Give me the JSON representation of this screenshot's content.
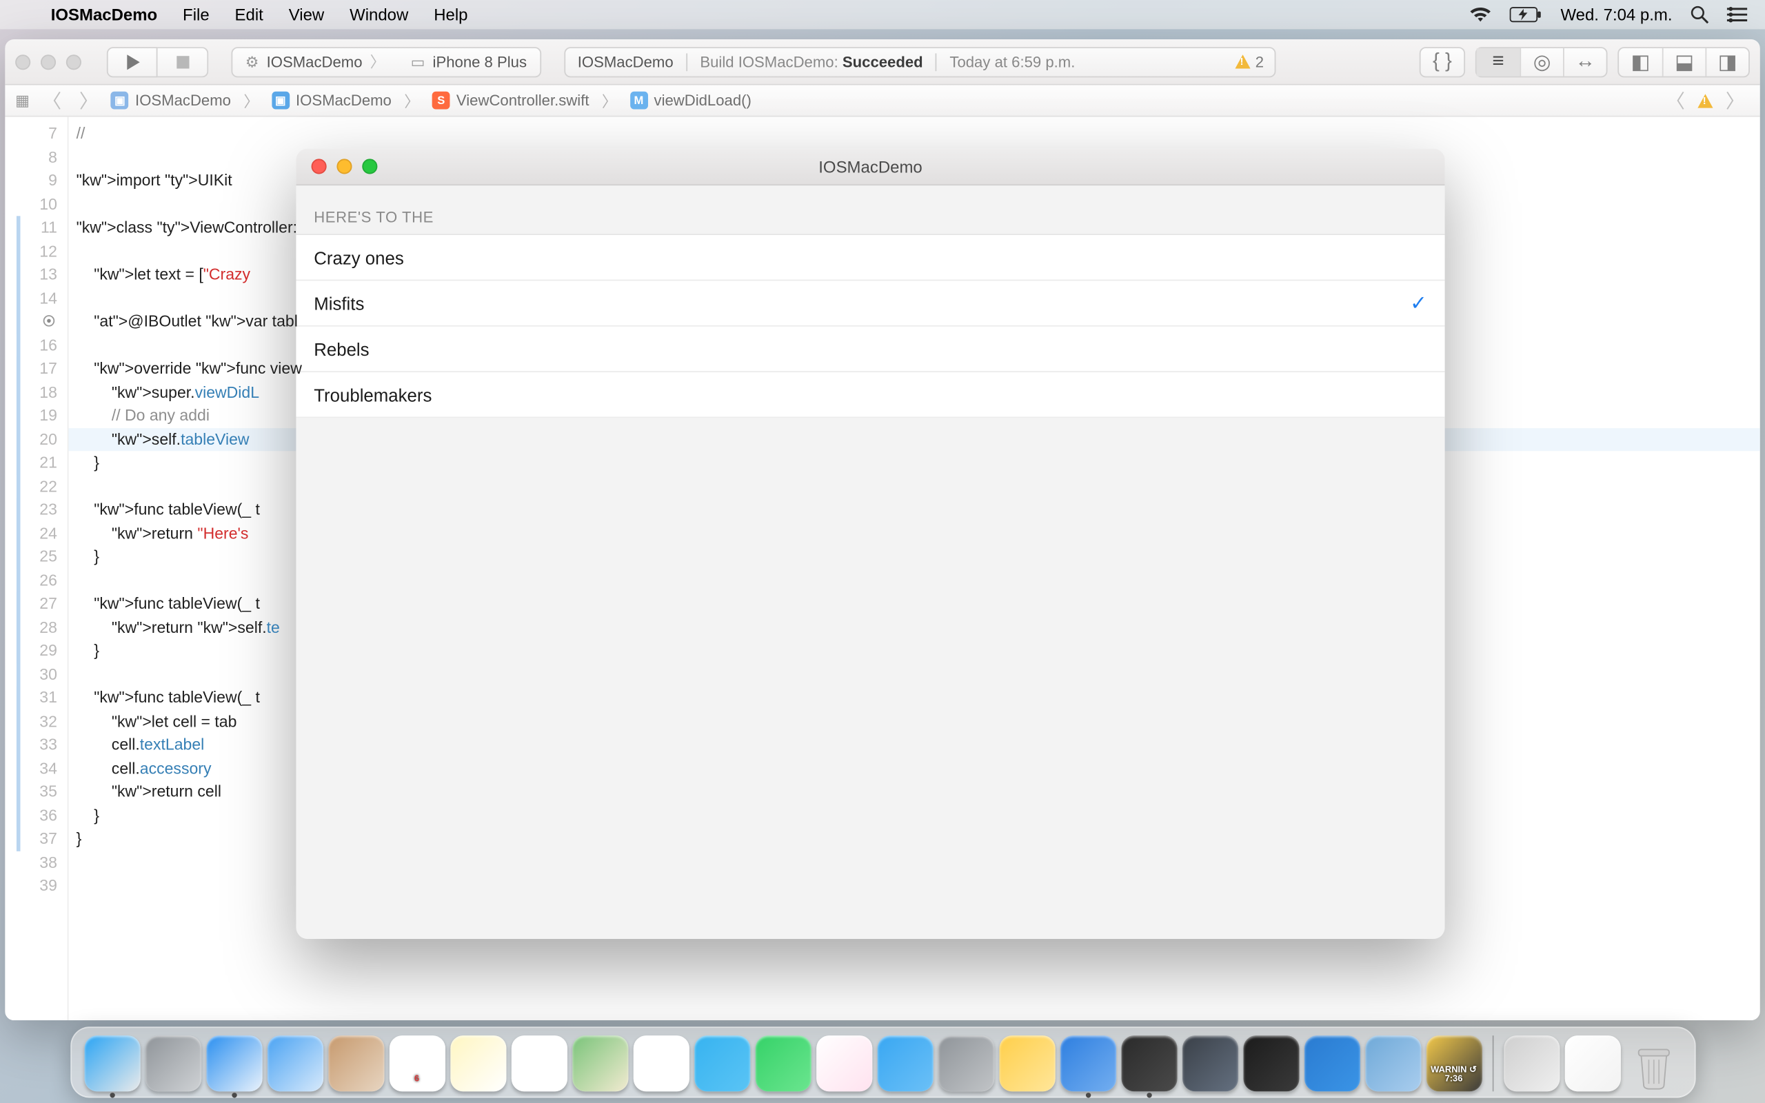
{
  "menubar": {
    "app": "IOSMacDemo",
    "items": [
      "File",
      "Edit",
      "View",
      "Window",
      "Help"
    ],
    "clock": "Wed. 7:04 p.m."
  },
  "xcode": {
    "scheme": {
      "project": "IOSMacDemo",
      "device": "iPhone 8 Plus"
    },
    "activity": {
      "project": "IOSMacDemo",
      "prefix": "Build IOSMacDemo: ",
      "status": "Succeeded",
      "time": "Today at 6:59 p.m.",
      "warn_count": "2"
    },
    "breadcrumbs": {
      "p0": "IOSMacDemo",
      "p1": "IOSMacDemo",
      "p2": "ViewController.swift",
      "p3": "viewDidLoad()"
    },
    "gutter_start": 7,
    "gutter_end": 39,
    "highlight_line": 20,
    "code_lines": [
      "//",
      "",
      "import UIKit",
      "",
      "class ViewController: ",
      "",
      "    let text = [\"Crazy",
      "",
      "    @IBOutlet var tabl",
      "",
      "    override func view",
      "        super.viewDidL",
      "        // Do any addi",
      "        self.tableView",
      "    }",
      "",
      "    func tableView(_ t",
      "        return \"Here's",
      "    }",
      "",
      "    func tableView(_ t",
      "        return self.te",
      "    }",
      "",
      "    func tableView(_ t",
      "        let cell = tab",
      "        cell.textLabel",
      "        cell.accessory",
      "        return cell",
      "    }",
      "}",
      "",
      ""
    ],
    "blue_bars": [
      [
        11,
        37
      ],
      [
        15,
        15
      ],
      [
        17,
        21
      ],
      [
        23,
        25
      ],
      [
        27,
        29
      ],
      [
        31,
        36
      ]
    ]
  },
  "appwin": {
    "title": "IOSMacDemo",
    "section": "HERE'S TO THE",
    "rows": [
      {
        "label": "Crazy ones",
        "checked": false
      },
      {
        "label": "Misfits",
        "checked": true
      },
      {
        "label": "Rebels",
        "checked": false
      },
      {
        "label": "Troublemakers",
        "checked": false
      }
    ]
  },
  "dock": {
    "apps": [
      {
        "n": "finder",
        "c1": "#2aa4f4",
        "c2": "#eaeaea",
        "running": true
      },
      {
        "n": "launchpad",
        "c1": "#8f9499",
        "c2": "#cfd2d5"
      },
      {
        "n": "safari",
        "c1": "#2a8ff0",
        "c2": "#eaf2fb",
        "running": true
      },
      {
        "n": "mail",
        "c1": "#4aa3f3",
        "c2": "#d7e9fb"
      },
      {
        "n": "contacts",
        "c1": "#c79a6e",
        "c2": "#e7d5c1"
      },
      {
        "n": "calendar",
        "c1": "#ffffff",
        "c2": "#ffffff",
        "lbl": "6",
        "lblc": "#d83939"
      },
      {
        "n": "notes",
        "c1": "#fff6c2",
        "c2": "#fff"
      },
      {
        "n": "reminders",
        "c1": "#ffffff",
        "c2": "#ffffff"
      },
      {
        "n": "maps",
        "c1": "#7ac47a",
        "c2": "#f1ead0"
      },
      {
        "n": "photos",
        "c1": "#ffffff",
        "c2": "#ffffff"
      },
      {
        "n": "messages",
        "c1": "#37b3f0",
        "c2": "#5ac4f5"
      },
      {
        "n": "facetime",
        "c1": "#35d268",
        "c2": "#6be58f"
      },
      {
        "n": "itunes",
        "c1": "#ffffff",
        "c2": "#ffe2ef"
      },
      {
        "n": "appstore",
        "c1": "#39a7f2",
        "c2": "#6bc0f7"
      },
      {
        "n": "sysprefs",
        "c1": "#8f9499",
        "c2": "#c1c4c7"
      },
      {
        "n": "sketch",
        "c1": "#ffcf4a",
        "c2": "#ffe69a"
      },
      {
        "n": "xcode",
        "c1": "#2e7fe0",
        "c2": "#73aef0",
        "running": true
      },
      {
        "n": "terminal",
        "c1": "#2a2a2a",
        "c2": "#4a4a4a",
        "running": true
      },
      {
        "n": "quicktime",
        "c1": "#3a4048",
        "c2": "#647080"
      },
      {
        "n": "voicememos",
        "c1": "#1b1b1b",
        "c2": "#3a3a3a"
      },
      {
        "n": "vscode",
        "c1": "#2a7bd1",
        "c2": "#3a94e6"
      },
      {
        "n": "preview",
        "c1": "#6fa9d8",
        "c2": "#a9cdee"
      },
      {
        "n": "console",
        "c1": "#f2c84a",
        "c2": "#3a3a3a",
        "lbl": "WARNIN\n↺ 7:36"
      }
    ],
    "right": [
      {
        "n": "blocked",
        "c1": "#cfcfcf",
        "c2": "#efefef"
      },
      {
        "n": "document",
        "c1": "#ffffff",
        "c2": "#f2f2f2"
      }
    ]
  }
}
